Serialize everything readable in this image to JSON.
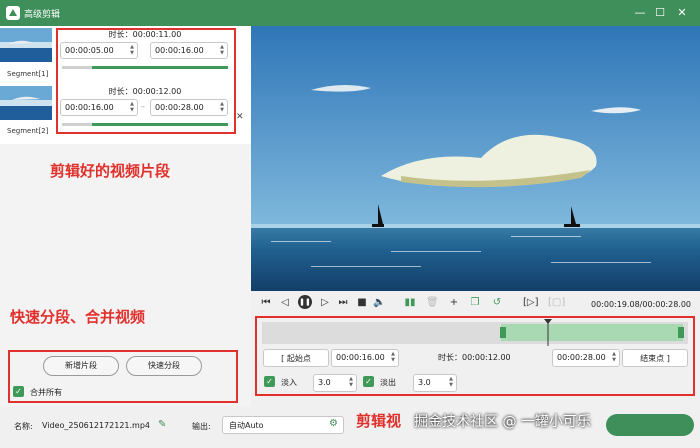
{
  "window": {
    "title": "高级剪辑",
    "minimize": "—",
    "maximize": "☐",
    "close": "✕"
  },
  "segments": [
    {
      "label": "Segment[1]",
      "duration": "时长：00:00:11.00",
      "start": "00:00:05.00",
      "end": "00:00:16.00",
      "progress": 0.82
    },
    {
      "label": "Segment[2]",
      "duration": "时长：00:00:12.00",
      "start": "00:00:16.00",
      "end": "00:00:28.00",
      "progress": 0.82
    }
  ],
  "annotations": {
    "segments_note": "剪辑好的视频片段",
    "split_note": "快速分段、合并视频",
    "edit_note": "剪辑视"
  },
  "left_buttons": {
    "add_segment": "新增片段",
    "quick_split": "快速分段",
    "merge_all": "合并所有"
  },
  "player": {
    "time_display": "00:00:19.08/00:00:28.00"
  },
  "timeline": {
    "playhead_fraction": 0.68,
    "range_start_fraction": 0.56,
    "range_end_fraction": 0.99
  },
  "trim": {
    "start_button": "[   起始点",
    "start_time": "00:00:16.00",
    "duration": "时长：00:00:12.00",
    "end_time": "00:00:28.00",
    "end_button": "结束点   ]",
    "fade_in_label": "淡入",
    "fade_in_value": "3.0",
    "fade_out_label": "淡出",
    "fade_out_value": "3.0"
  },
  "bottom": {
    "name_label": "名称:",
    "name_value": "Video_250612172121.mp4",
    "output_label": "输出:",
    "output_value": "自动Auto",
    "watermark": "掘金技术社区 @ 一罐小可乐"
  },
  "colors": {
    "accent": "#3f8f5a",
    "annotation": "#e0312d"
  }
}
